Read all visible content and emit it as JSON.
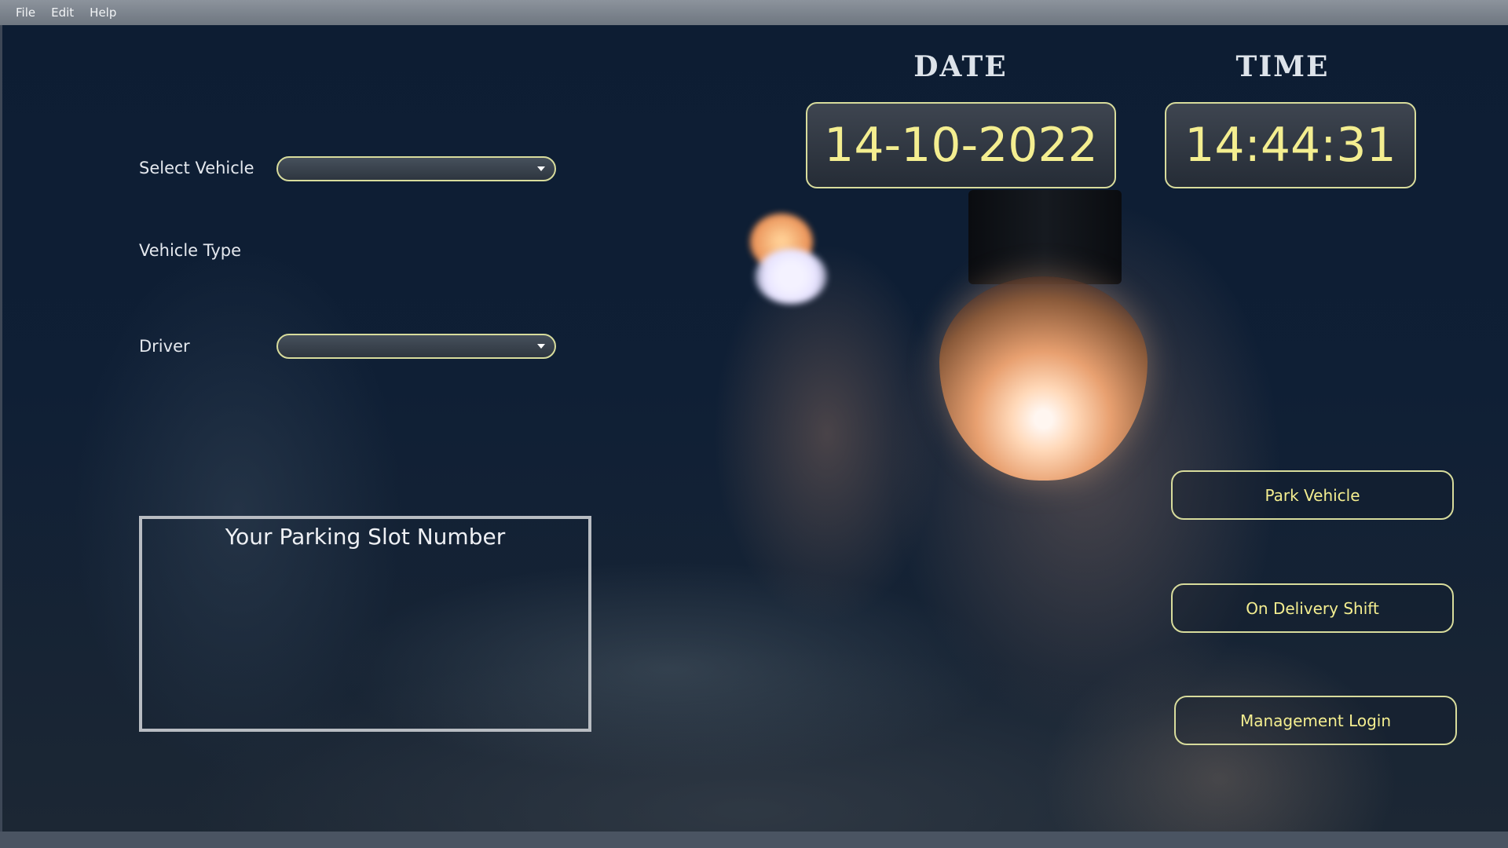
{
  "menu": {
    "items": [
      {
        "label": "File"
      },
      {
        "label": "Edit"
      },
      {
        "label": "Help"
      }
    ]
  },
  "form": {
    "select_vehicle_label": "Select Vehicle",
    "select_vehicle_value": "",
    "vehicle_type_label": "Vehicle Type",
    "vehicle_type_value": "",
    "driver_label": "Driver",
    "driver_value": ""
  },
  "clock": {
    "date_heading": "DATE",
    "date_value": "14-10-2022",
    "time_heading": "TIME",
    "time_value": "14:44:31"
  },
  "slot": {
    "title": "Your Parking Slot Number",
    "value": ""
  },
  "actions": {
    "park_vehicle": "Park Vehicle",
    "on_delivery_shift": "On Delivery Shift",
    "management_login": "Management Login"
  },
  "colors": {
    "accent_text": "#f4ee90",
    "accent_border": "#d8dc9c",
    "background": "#0f1f35"
  },
  "icons": {
    "dropdown": "chevron-down-icon"
  }
}
